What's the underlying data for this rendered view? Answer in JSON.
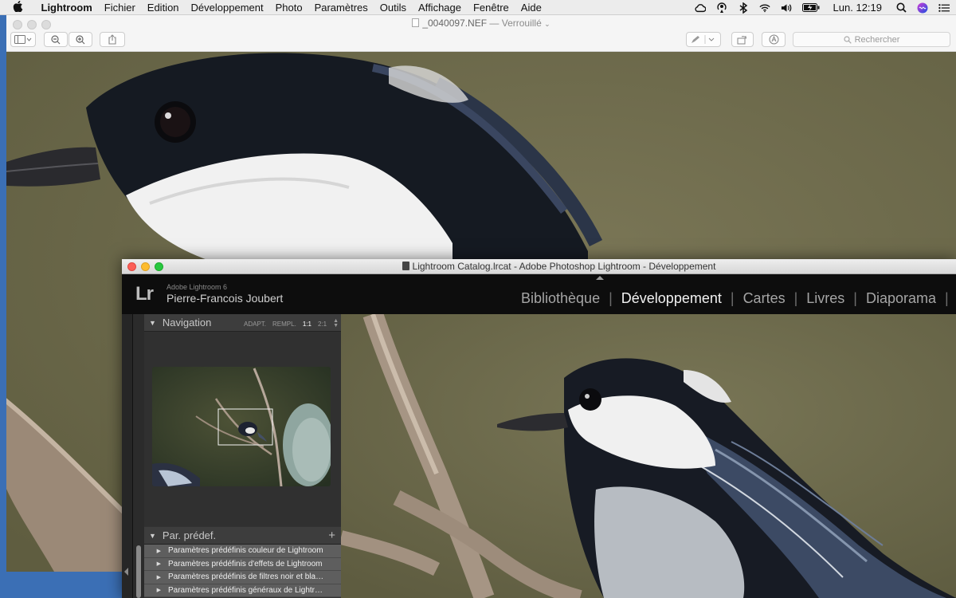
{
  "menubar": {
    "items": [
      "Lightroom",
      "Fichier",
      "Edition",
      "Développement",
      "Photo",
      "Paramètres",
      "Outils",
      "Affichage",
      "Fenêtre",
      "Aide"
    ],
    "clock": "Lun. 12:19",
    "tray_icons": [
      "creative-cloud-icon",
      "airplay-icon",
      "bluetooth-icon",
      "wifi-icon",
      "volume-icon",
      "battery-icon"
    ]
  },
  "preview": {
    "filename": "_0040097.NEF",
    "lock_status": "— Verrouillé",
    "search_placeholder": "Rechercher"
  },
  "lightroom": {
    "window_title": "Lightroom Catalog.lrcat - Adobe Photoshop Lightroom - Développement",
    "logo": "Lr",
    "product": "Adobe Lightroom 6",
    "user": "Pierre-Francois Joubert",
    "modules": [
      "Bibliothèque",
      "Développement",
      "Cartes",
      "Livres",
      "Diaporama",
      "I"
    ],
    "active_module": "Développement",
    "navigator": {
      "title": "Navigation",
      "zoom_options": [
        "ADAPT.",
        "REMPL.",
        "1:1",
        "2:1"
      ],
      "selected_zoom": "1:1"
    },
    "presets": {
      "title": "Par. prédef.",
      "add": "+",
      "items": [
        "Paramètres prédéfinis couleur de Lightroom",
        "Paramètres prédéfinis d'effets de Lightroom",
        "Paramètres prédéfinis de filtres noir et bla…",
        "Paramètres prédéfinis généraux de Lightr…"
      ]
    }
  },
  "colors": {
    "background_green": "#6f6c4c",
    "lr_header": "#0d0d0d",
    "lr_panel": "#333333",
    "desktop_blue": "#3b6fb5"
  }
}
